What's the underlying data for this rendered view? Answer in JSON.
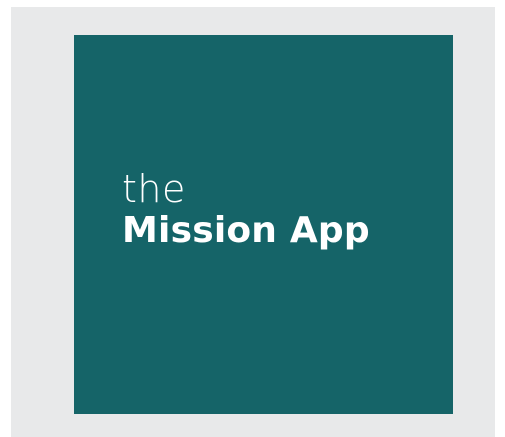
{
  "app_icon": {
    "tile_color": "#156468",
    "frame_color": "#e8e9ea",
    "text_color": "#ffffff",
    "line1": "the",
    "line2": "Mission App"
  }
}
